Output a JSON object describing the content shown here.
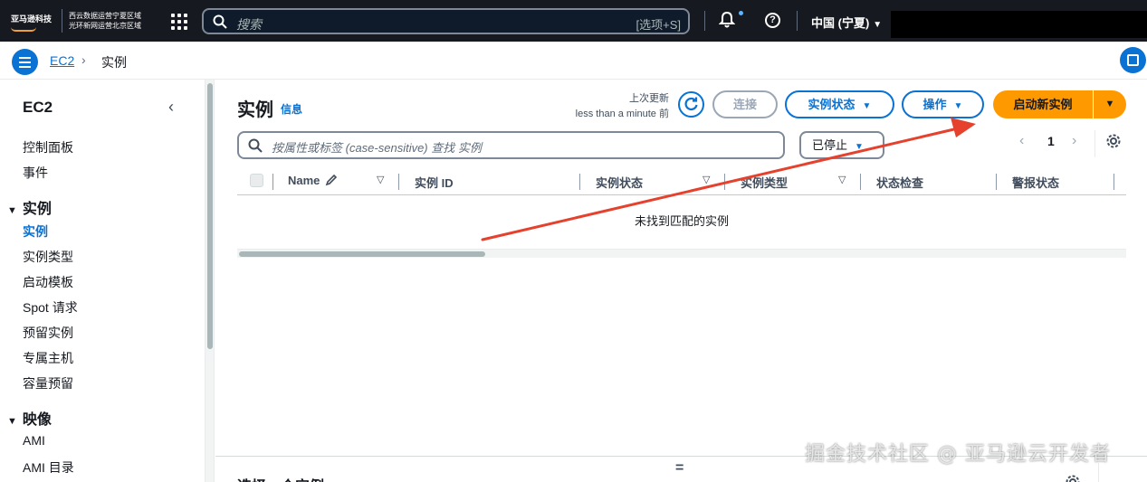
{
  "topnav": {
    "logo_text": "亚马逊科技",
    "region_note_line1": "西云数据运营宁夏区域",
    "region_note_line2": "光环新网运营北京区域",
    "search_placeholder": "搜索",
    "search_shortcut": "[选项+S]",
    "region_label": "中国 (宁夏)",
    "icons": [
      "apps-grid-icon",
      "search-icon",
      "bell-icon",
      "help-icon"
    ]
  },
  "breadcrumb": {
    "root": "EC2",
    "separator": "›",
    "current": "实例"
  },
  "sidebar": {
    "title": "EC2",
    "items_top": [
      {
        "label": "控制面板"
      },
      {
        "label": "事件"
      }
    ],
    "section_instances": {
      "label": "实例",
      "items": [
        {
          "label": "实例",
          "active": true
        },
        {
          "label": "实例类型"
        },
        {
          "label": "启动模板"
        },
        {
          "label": "Spot 请求"
        },
        {
          "label": "预留实例"
        },
        {
          "label": "专属主机"
        },
        {
          "label": "容量预留"
        }
      ]
    },
    "section_images": {
      "label": "映像",
      "items": [
        {
          "label": "AMI"
        },
        {
          "label": "AMI 目录"
        }
      ]
    }
  },
  "main": {
    "title": "实例",
    "info_link": "信息",
    "last_updated_label": "上次更新",
    "last_updated_value": "less than a minute 前",
    "connect_button": "连接",
    "instance_state_button": "实例状态",
    "actions_button": "操作",
    "launch_button": "启动新实例",
    "filter_placeholder": "按属性或标签 (case-sensitive) 查找 实例",
    "state_filter": "已停止",
    "page_number": "1",
    "columns": [
      "Name",
      "实例 ID",
      "实例状态",
      "实例类型",
      "状态检查",
      "警报状态"
    ],
    "empty_message": "未找到匹配的实例",
    "lower_panel_title": "选择一个实例",
    "split_handle": "="
  },
  "watermark": "掘金技术社区 @ 亚马逊云开发者",
  "colors": {
    "accent_blue": "#0972d3",
    "primary_orange": "#ff9900",
    "annotation_arrow": "#e5412d",
    "topbar_bg": "#16191f"
  }
}
